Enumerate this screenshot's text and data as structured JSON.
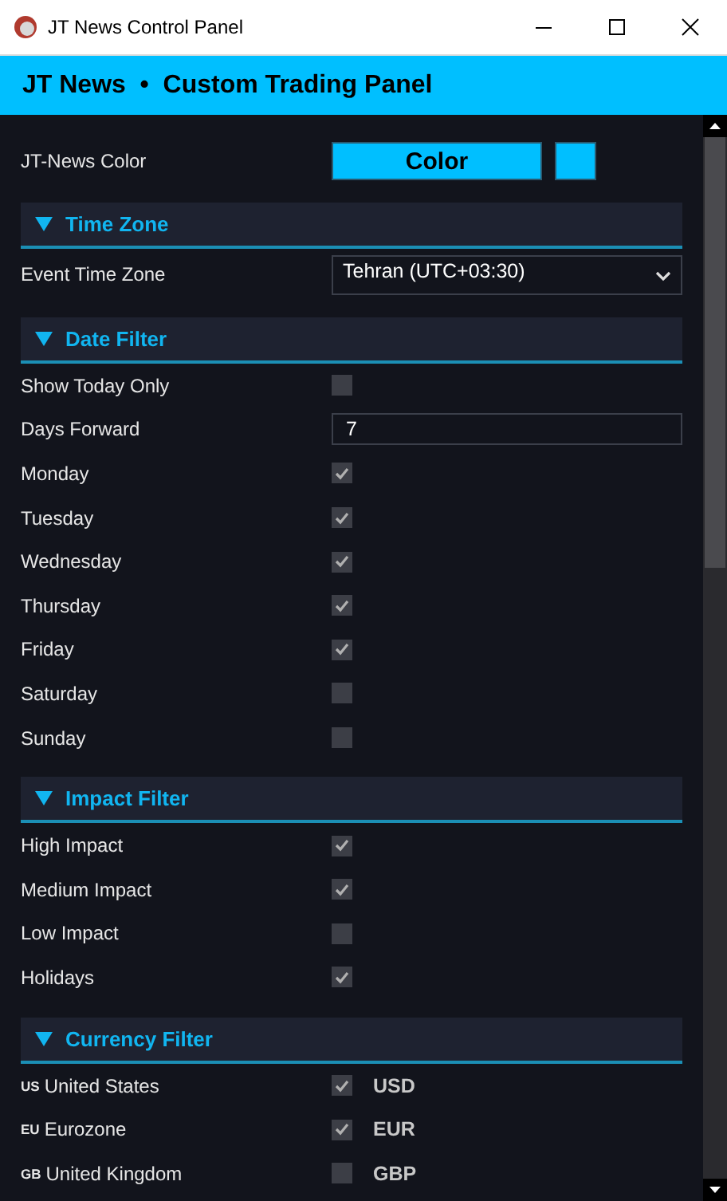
{
  "window": {
    "title": "JT News Control Panel"
  },
  "header": {
    "title": "JT News  •  Custom Trading Panel"
  },
  "color_setting": {
    "label": "JT-News Color",
    "button": "Color",
    "color": "#00bfff"
  },
  "sections": [
    {
      "title": "Time Zone",
      "expanded": true,
      "rows": [
        {
          "kind": "dropdown",
          "label": "Event Time Zone",
          "value": "Tehran (UTC+03:30)"
        }
      ]
    },
    {
      "title": "Date Filter",
      "expanded": true,
      "rows": [
        {
          "kind": "checkbox",
          "label": "Show Today Only",
          "checked": false
        },
        {
          "kind": "text",
          "label": "Days Forward",
          "value": "7"
        },
        {
          "kind": "checkbox",
          "label": "Monday",
          "checked": true
        },
        {
          "kind": "checkbox",
          "label": "Tuesday",
          "checked": true
        },
        {
          "kind": "checkbox",
          "label": "Wednesday",
          "checked": true
        },
        {
          "kind": "checkbox",
          "label": "Thursday",
          "checked": true
        },
        {
          "kind": "checkbox",
          "label": "Friday",
          "checked": true
        },
        {
          "kind": "checkbox",
          "label": "Saturday",
          "checked": false
        },
        {
          "kind": "checkbox",
          "label": "Sunday",
          "checked": false
        }
      ]
    },
    {
      "title": "Impact Filter",
      "expanded": true,
      "rows": [
        {
          "kind": "checkbox",
          "label": "High Impact",
          "checked": true
        },
        {
          "kind": "checkbox",
          "label": "Medium Impact",
          "checked": true
        },
        {
          "kind": "checkbox",
          "label": "Low Impact",
          "checked": false
        },
        {
          "kind": "checkbox",
          "label": "Holidays",
          "checked": true
        }
      ]
    },
    {
      "title": "Currency Filter",
      "expanded": true,
      "rows": [
        {
          "kind": "currency",
          "flag": "US",
          "label": "United States",
          "checked": true,
          "code": "USD"
        },
        {
          "kind": "currency",
          "flag": "EU",
          "label": "Eurozone",
          "checked": true,
          "code": "EUR"
        },
        {
          "kind": "currency",
          "flag": "GB",
          "label": "United Kingdom",
          "checked": false,
          "code": "GBP"
        }
      ]
    }
  ]
}
